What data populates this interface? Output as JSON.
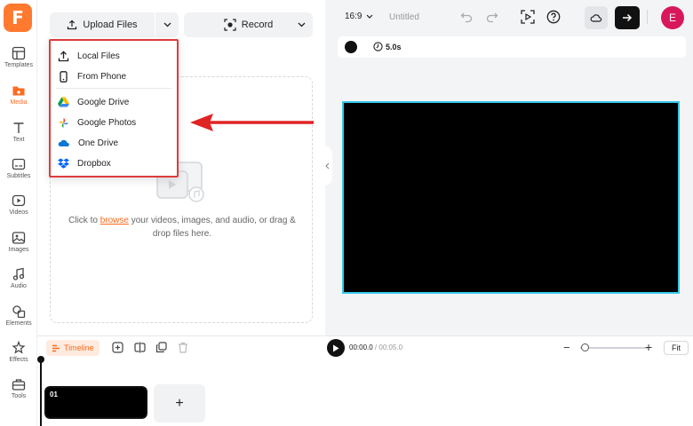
{
  "app": {
    "logo_letter": "F"
  },
  "sidebar": {
    "items": [
      {
        "label": "Templates",
        "icon": "templates-icon"
      },
      {
        "label": "Media",
        "icon": "media-icon",
        "active": true
      },
      {
        "label": "Text",
        "icon": "text-icon"
      },
      {
        "label": "Subtitles",
        "icon": "subtitles-icon"
      },
      {
        "label": "Videos",
        "icon": "videos-icon"
      },
      {
        "label": "Images",
        "icon": "images-icon"
      },
      {
        "label": "Audio",
        "icon": "audio-icon"
      },
      {
        "label": "Elements",
        "icon": "elements-icon"
      },
      {
        "label": "Effects",
        "icon": "effects-icon"
      },
      {
        "label": "Tools",
        "icon": "tools-icon"
      }
    ]
  },
  "media_panel": {
    "upload_label": "Upload Files",
    "record_label": "Record",
    "dropzone": {
      "prefix": "Click to ",
      "link": "browse",
      "suffix": " your videos, images, and audio, or drag & drop files here."
    }
  },
  "upload_menu": {
    "items": [
      {
        "label": "Local Files",
        "icon": "upload-icon"
      },
      {
        "label": "From Phone",
        "icon": "phone-icon"
      },
      {
        "label": "Google Drive",
        "icon": "google-drive-icon"
      },
      {
        "label": "Google Photos",
        "icon": "google-photos-icon"
      },
      {
        "label": "One Drive",
        "icon": "onedrive-icon"
      },
      {
        "label": "Dropbox",
        "icon": "dropbox-icon"
      }
    ]
  },
  "topbar": {
    "aspect_ratio": "16:9",
    "project_title": "Untitled",
    "avatar_initial": "E"
  },
  "properties": {
    "duration": "5.0s",
    "background_color": "#000000"
  },
  "timeline": {
    "tab_label": "Timeline",
    "current_time": "00:00.0",
    "total_time": "00:05.0",
    "fit_label": "Fit",
    "zoom_level": 0.05,
    "clips": [
      {
        "number": "01"
      }
    ],
    "add_label": "+"
  },
  "colors": {
    "accent": "#ff6a1f",
    "highlight_border": "#e03a3a",
    "canvas_outline": "#35c8e8",
    "avatar": "#d8185a"
  }
}
